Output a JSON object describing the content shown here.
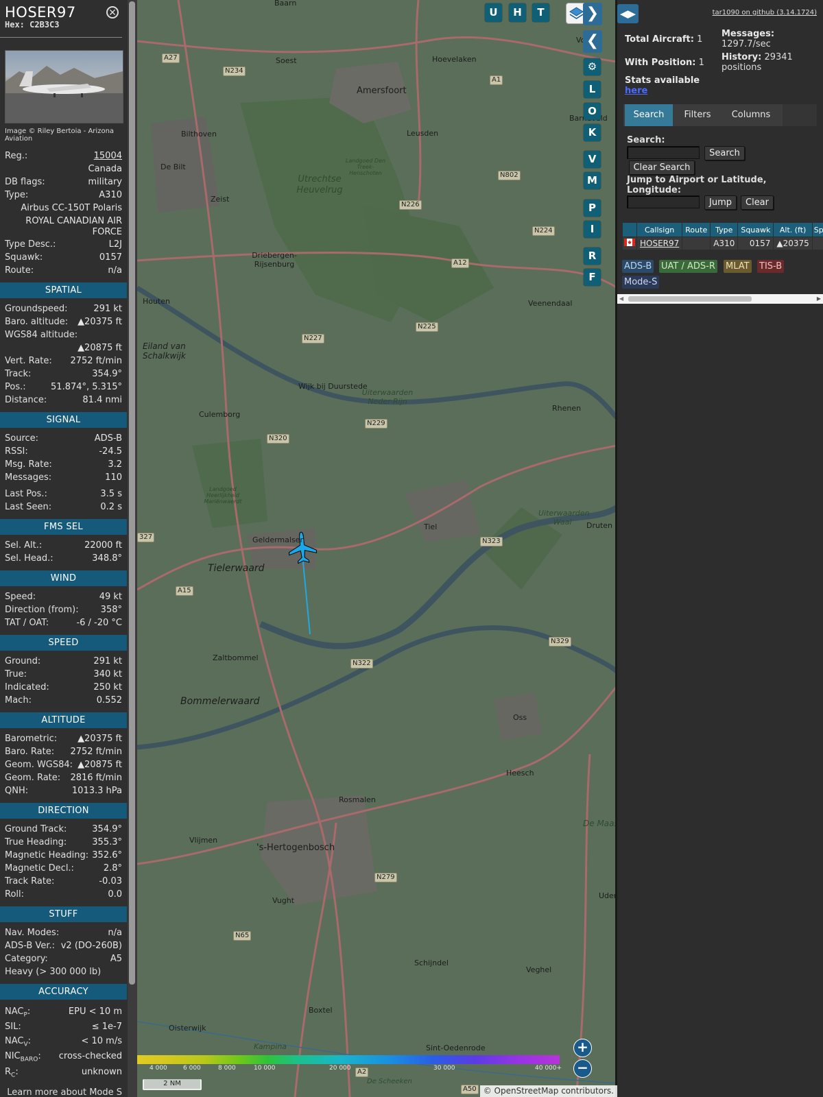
{
  "aircraft": {
    "callsign": "HOSER97",
    "hex": "Hex: C2B3C3",
    "photo_credit": "Image © Riley Bertoia - Arizona Aviation",
    "reg_label": "Reg.:",
    "reg_value": "15004",
    "country": "Canada",
    "dbflags_label": "DB flags:",
    "dbflags_value": "military",
    "type_label": "Type:",
    "type_value": "A310",
    "type_name": "Airbus CC-150T Polaris",
    "operator": "ROYAL CANADIAN AIR FORCE",
    "typedesc_label": "Type Desc.:",
    "typedesc_value": "L2J",
    "squawk_label": "Squawk:",
    "squawk_value": "0157",
    "route_label": "Route:",
    "route_value": "n/a"
  },
  "sections": {
    "spatial": "SPATIAL",
    "signal": "SIGNAL",
    "fms": "FMS SEL",
    "wind": "WIND",
    "speed": "SPEED",
    "altitude": "ALTITUDE",
    "direction": "DIRECTION",
    "stuff": "STUFF",
    "accuracy": "ACCURACY"
  },
  "spatial": [
    {
      "label": "Groundspeed:",
      "value": "291 kt"
    },
    {
      "label": "Baro. altitude:",
      "value": "▲20375 ft"
    },
    {
      "label": "WGS84 altitude:",
      "value": ""
    },
    {
      "label": "",
      "value": "▲20875 ft"
    },
    {
      "label": "Vert. Rate:",
      "value": "2752 ft/min"
    },
    {
      "label": "Track:",
      "value": "354.9°"
    },
    {
      "label": "Pos.:",
      "value": "51.874°, 5.315°"
    },
    {
      "label": "Distance:",
      "value": "81.4 nmi"
    }
  ],
  "signal": [
    {
      "label": "Source:",
      "value": "ADS-B"
    },
    {
      "label": "RSSI:",
      "value": "-24.5"
    },
    {
      "label": "Msg. Rate:",
      "value": "3.2"
    },
    {
      "label": "Messages:",
      "value": "110"
    }
  ],
  "signal2": [
    {
      "label": "Last Pos.:",
      "value": "3.5 s"
    },
    {
      "label": "Last Seen:",
      "value": "0.2 s"
    }
  ],
  "fms": [
    {
      "label": "Sel. Alt.:",
      "value": "22000 ft"
    },
    {
      "label": "Sel. Head.:",
      "value": "348.8°"
    }
  ],
  "wind": [
    {
      "label": "Speed:",
      "value": "49 kt"
    },
    {
      "label": "Direction (from):",
      "value": "358°"
    },
    {
      "label": "TAT / OAT:",
      "value": "-6 / -20 °C"
    }
  ],
  "speed": [
    {
      "label": "Ground:",
      "value": "291 kt"
    },
    {
      "label": "True:",
      "value": "340 kt"
    },
    {
      "label": "Indicated:",
      "value": "250 kt"
    },
    {
      "label": "Mach:",
      "value": "0.552"
    }
  ],
  "altitude": [
    {
      "label": "Barometric:",
      "value": "▲20375 ft"
    },
    {
      "label": "Baro. Rate:",
      "value": "2752 ft/min"
    },
    {
      "label": "Geom. WGS84:",
      "value": "▲20875 ft"
    },
    {
      "label": "Geom. Rate:",
      "value": "2816 ft/min"
    },
    {
      "label": "QNH:",
      "value": "1013.3 hPa"
    }
  ],
  "direction": [
    {
      "label": "Ground Track:",
      "value": "354.9°"
    },
    {
      "label": "True Heading:",
      "value": "355.3°"
    },
    {
      "label": "Magnetic Heading:",
      "value": "352.6°"
    },
    {
      "label": "Magnetic Decl.:",
      "value": "2.8°"
    },
    {
      "label": "Track Rate:",
      "value": "-0.03"
    },
    {
      "label": "Roll:",
      "value": "0.0"
    }
  ],
  "stuff": [
    {
      "label": "Nav. Modes:",
      "value": "n/a"
    },
    {
      "label": "ADS-B Ver.:",
      "value": "v2 (DO-260B)"
    },
    {
      "label": "Category:",
      "value": "A5"
    },
    {
      "label": "Heavy (> 300 000 lb)",
      "value": ""
    }
  ],
  "accuracy": {
    "nacp_label": "NAC",
    "nacp_sub": "P",
    "nacp_value": "EPU < 10 m",
    "sil_label": "SIL:",
    "sil_value": "≤ 1e-7",
    "nacv_label": "NAC",
    "nacv_sub": "V",
    "nacv_value": "< 10 m/s",
    "nicbaro_label": "NIC",
    "nicbaro_sub": "BARO",
    "nicbaro_value": "cross-checked",
    "rc_label": "R",
    "rc_sub": "C",
    "rc_value": "unknown"
  },
  "learn_more": "Learn more about Mode S data type by hovering over",
  "map": {
    "buttons": [
      "U",
      "H",
      "T",
      "L",
      "O",
      "K",
      "V",
      "M",
      "P",
      "I",
      "R",
      "F"
    ],
    "places": {
      "baarn": "Baarn",
      "soest": "Soest",
      "amersfoort": "Amersfoort",
      "hoevelaken": "Hoevelaken",
      "leusden": "Leusden",
      "bilthoven": "Bilthoven",
      "debilt": "De Bilt",
      "zeist": "Zeist",
      "heuvelrug": "Utrechtse Heuvelrug",
      "landgoed1": "Landgoed Den Treek-Henschoten",
      "barneveld": "Barneveld",
      "driebergen": "Driebergen-Rijsenburg",
      "veenendaal": "Veenendaal",
      "houten": "Houten",
      "eiland": "Eiland van Schalkwijk",
      "wijk": "Wijk bij Duurstede",
      "uiterwaarden1": "Uiterwaarden Neder-Rijn",
      "rhenen": "Rhenen",
      "culemborg": "Culemborg",
      "landgoed2": "Landgoed Heerlijkheid Mariënwaerdt",
      "geldermalsen": "Geldermalsen",
      "tiel": "Tiel",
      "uiterwaarden2": "Uiterwaarden Waal",
      "druten": "Druten",
      "tielerwaard": "Tielerwaard",
      "zaltbommel": "Zaltbommel",
      "bommelerwaard": "Bommelerwaard",
      "oss": "Oss",
      "heesch": "Heesch",
      "rosmalen": "Rosmalen",
      "vlijmen": "Vlijmen",
      "denbosch": "'s-Hertogenbosch",
      "demaas": "De Maas",
      "uden": "Uden",
      "vught": "Vught",
      "schijndel": "Schijndel",
      "veghel": "Veghel",
      "boxtel": "Boxtel",
      "oisterwijk": "Oisterwijk",
      "sintoedenrode": "Sint-Oedenrode",
      "descheeken": "De Scheeken",
      "voorthuizen": "Voor",
      "kampina": "Kampina"
    },
    "roads": {
      "a27": "A27",
      "n234": "N234",
      "a1": "A1",
      "n802": "N802",
      "n226": "N226",
      "n224": "N224",
      "a12": "A12",
      "n225": "N225",
      "n227": "N227",
      "n229": "N229",
      "n320": "N320",
      "r327": "327",
      "n323": "N323",
      "a15": "A15",
      "n329": "N329",
      "n322": "N322",
      "n279": "N279",
      "n65": "N65",
      "a2": "A2",
      "a50": "A50"
    },
    "altitude_scale": [
      "4 000",
      "6 000",
      "8 000",
      "10 000",
      "20 000",
      "30 000",
      "40 000+"
    ],
    "scale_label": "2 NM",
    "attribution": "© OpenStreetMap contributors."
  },
  "right_panel": {
    "github": "tar1090 on github (3.14.1724)",
    "total_aircraft_label": "Total Aircraft:",
    "total_aircraft_value": "1",
    "with_position_label": "With Position:",
    "with_position_value": "1",
    "messages_label": "Messages:",
    "messages_value": "1297.7/sec",
    "history_label": "History:",
    "history_value": "29341 positions",
    "stats_label": "Stats available",
    "stats_link": "here",
    "tabs": [
      "Search",
      "Filters",
      "Columns"
    ],
    "search_label": "Search:",
    "search_button": "Search",
    "clear_search_button": "Clear Search",
    "jump_label": "Jump to Airport or Latitude, Longitude:",
    "jump_button": "Jump",
    "clear_button": "Clear",
    "table_headers": [
      "Callsign",
      "Route",
      "Type",
      "Squawk",
      "Alt. (ft)",
      "Sp"
    ],
    "table_row": {
      "callsign": "HOSER97",
      "route": "",
      "type": "A310",
      "squawk": "0157",
      "alt": "▲20375"
    },
    "badges": [
      "ADS-B",
      "UAT / ADS-R",
      "MLAT",
      "TIS-B",
      "Mode-S"
    ]
  },
  "colors": {
    "section_bg": "#155a7a",
    "button_teal": "#0f6077",
    "badge_adsb": "#2a4a68",
    "badge_uat": "#3a6a3a",
    "badge_mlat": "#6a5a30",
    "badge_tisb": "#6a2a2a",
    "track": "#22a8e0"
  }
}
